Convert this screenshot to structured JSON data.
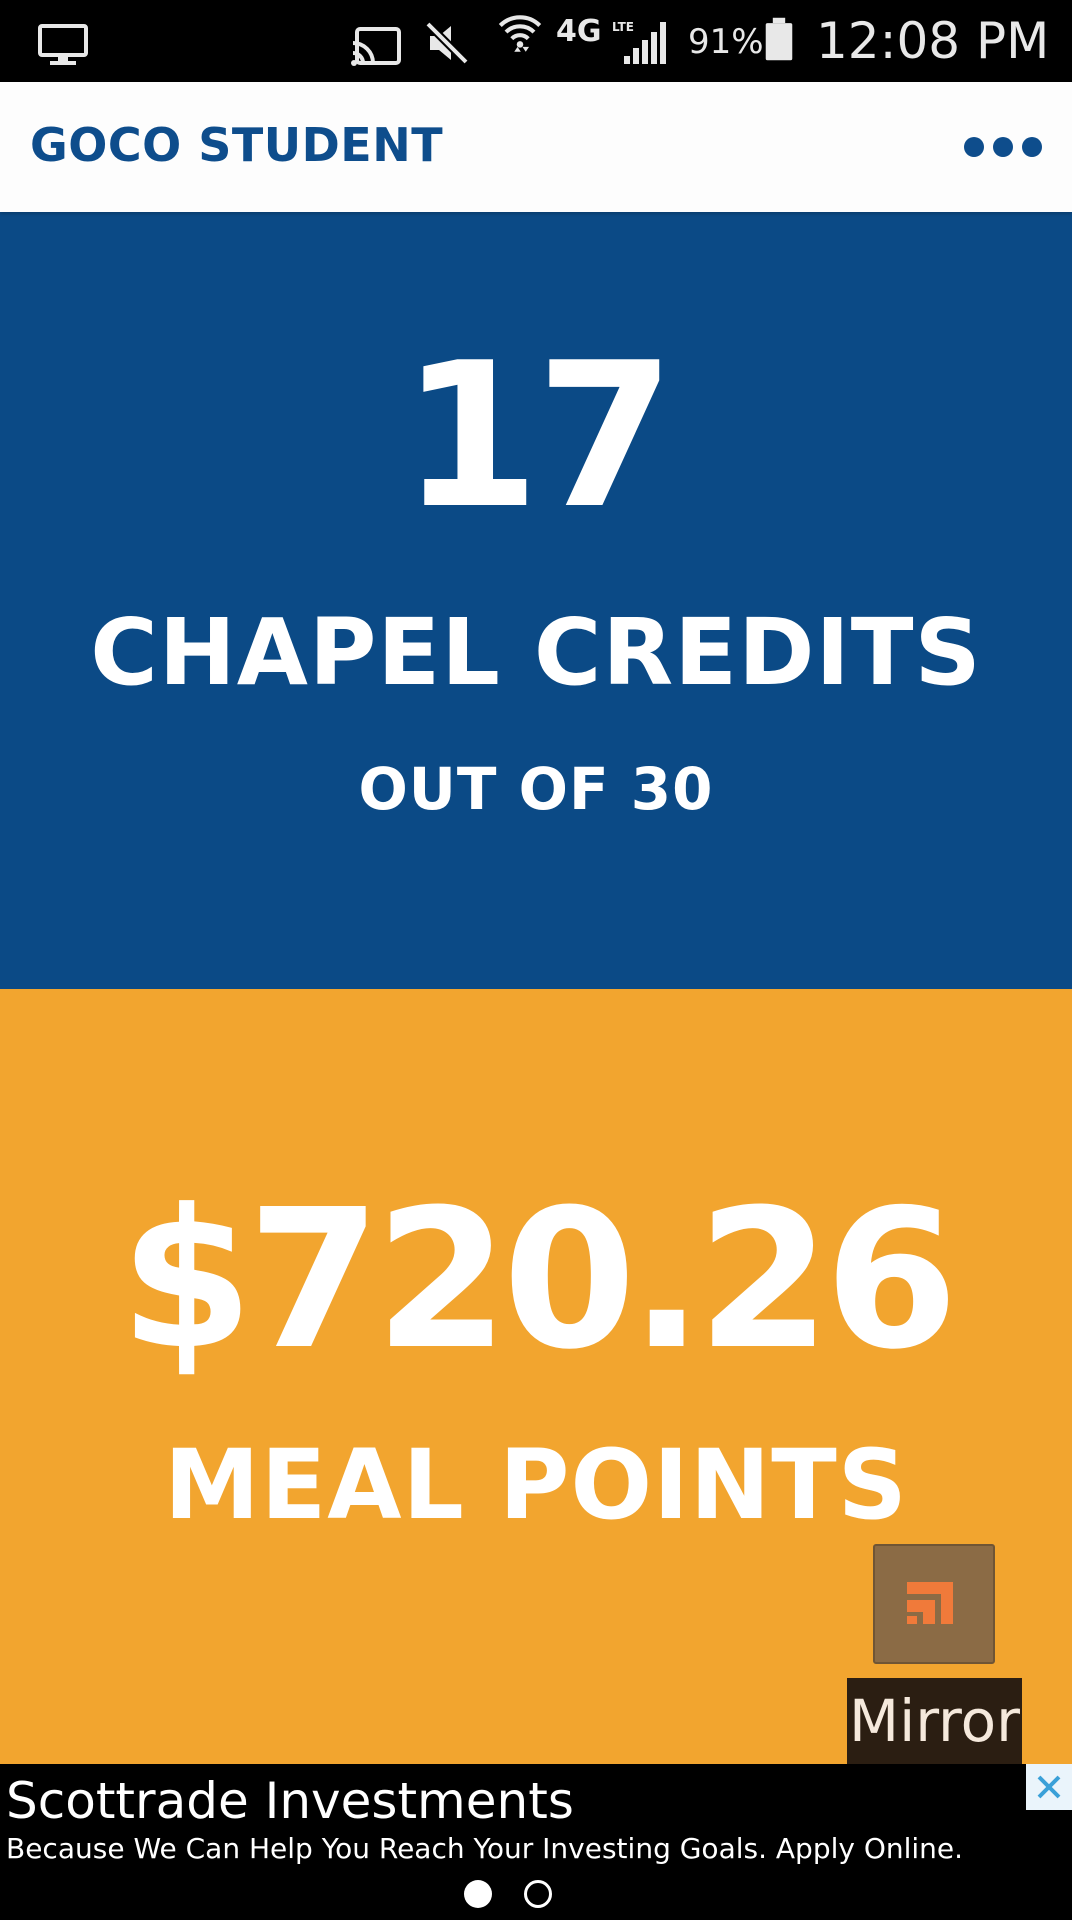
{
  "status_bar": {
    "battery": "91%",
    "time": "12:08 PM",
    "network": "4G",
    "icons": [
      "desktop-icon",
      "cast-icon",
      "mute-icon",
      "wifi-icon",
      "network-4g-icon",
      "signal-icon",
      "battery-icon"
    ]
  },
  "header": {
    "title": "GOCO STUDENT",
    "menu_icon": "more-dots-icon"
  },
  "chapel": {
    "count": "17",
    "label": "CHAPEL CREDITS",
    "sub": "OUT OF 30"
  },
  "meal": {
    "amount": "$720.26",
    "label": "MEAL POINTS"
  },
  "overlay": {
    "mirror_label": "Mirror",
    "mirror_icon": "mirror-app-icon"
  },
  "ad": {
    "title": "Scottrade Investments",
    "description": "Because We Can Help You Reach Your Investing Goals. Apply Online.",
    "close_icon": "close-icon",
    "pages": 2,
    "active_page": 1
  },
  "colors": {
    "brand_blue": "#0b4a86",
    "header_blue": "#0e4d8c",
    "meal_orange": "#f2a52f",
    "mirror_brown": "#8b6b45",
    "mirror_icon_orange": "#f07a3a"
  }
}
